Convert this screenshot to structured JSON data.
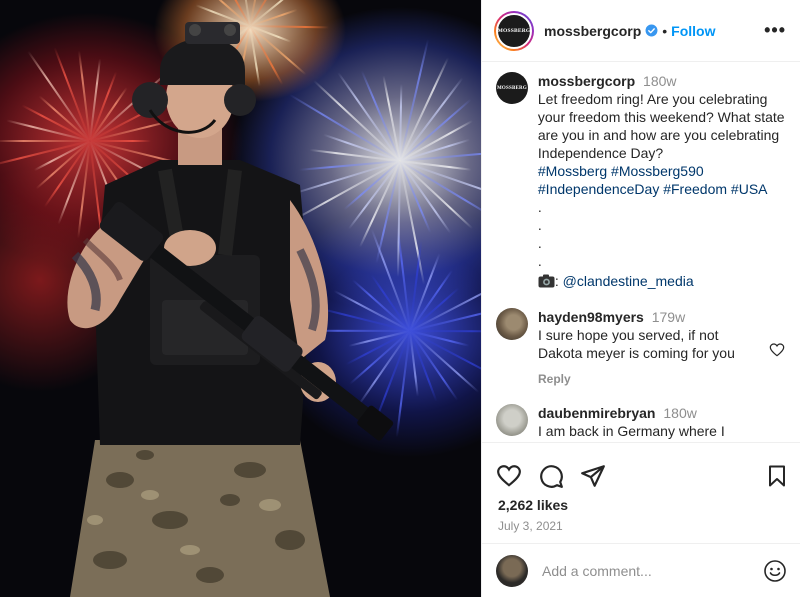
{
  "post": {
    "account": "mossbergcorp",
    "avatar_text": "MOSSBERG",
    "dot": "•",
    "follow_label": "Follow",
    "more_label": "•••"
  },
  "caption": {
    "username": "mossbergcorp",
    "time": "180w",
    "text": "Let freedom ring! Are you celebrating your freedom this weekend? What state are you in and how are you celebrating Independence Day?",
    "hashtags": [
      "#Mossberg",
      "#Mossberg590",
      "#IndependenceDay",
      "#Freedom",
      "#USA"
    ],
    "dots": [
      ".",
      ".",
      ".",
      "."
    ],
    "credit_prefix": ": ",
    "credit": "@clandestine_media"
  },
  "comments": [
    {
      "username": "hayden98myers",
      "time": "179w",
      "text": "I sure hope you served, if not Dakota meyer is coming for you",
      "reply_label": "Reply"
    },
    {
      "username": "daubenmirebryan",
      "time": "180w",
      "text": "I am back in Germany where I"
    }
  ],
  "likes": "2,262 likes",
  "date": "July 3, 2021",
  "add_comment_placeholder": "Add a comment...",
  "colors": {
    "accent": "#0095f6",
    "hashtag": "#00376b",
    "verified": "#3897f0",
    "muted": "#8e8e8e"
  }
}
